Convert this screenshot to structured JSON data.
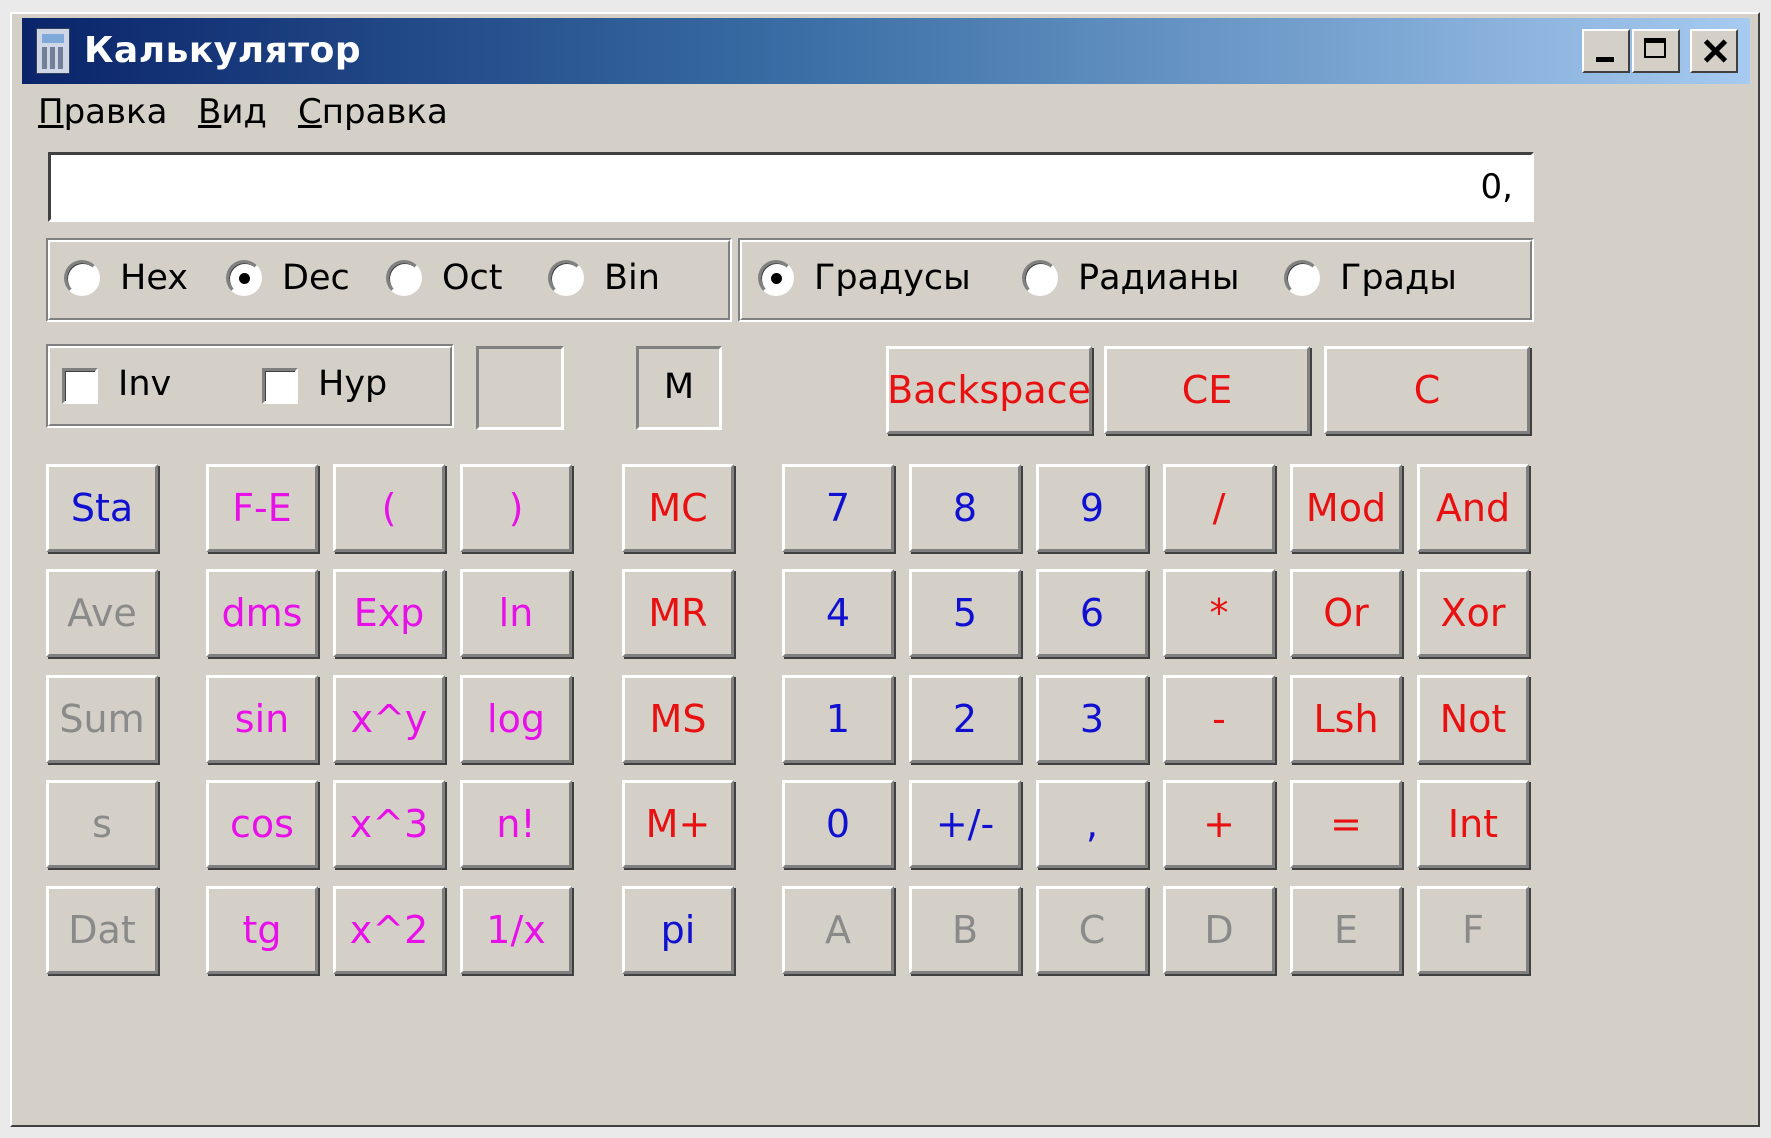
{
  "window": {
    "title": "Калькулятор"
  },
  "menu": [
    {
      "first": "П",
      "rest": "равка"
    },
    {
      "first": "В",
      "rest": "ид"
    },
    {
      "first": "С",
      "rest": "правка"
    }
  ],
  "display": {
    "value": "0,"
  },
  "base_modes": [
    {
      "label": "Hex",
      "selected": false
    },
    {
      "label": "Dec",
      "selected": true
    },
    {
      "label": "Oct",
      "selected": false
    },
    {
      "label": "Bin",
      "selected": false
    }
  ],
  "angle_modes": [
    {
      "label": "Градусы",
      "selected": true
    },
    {
      "label": "Радианы",
      "selected": false
    },
    {
      "label": "Грады",
      "selected": false
    }
  ],
  "checks": [
    {
      "label": "Inv",
      "checked": false
    },
    {
      "label": "Hyp",
      "checked": false
    }
  ],
  "paren_indicator": "",
  "memory_indicator": "M",
  "edit_buttons": [
    {
      "label": "Backspace",
      "color": "#e81010"
    },
    {
      "label": "CE",
      "color": "#e81010"
    },
    {
      "label": "C",
      "color": "#e81010"
    }
  ],
  "colors": {
    "red": "#e81010",
    "magenta": "#e810e8",
    "blue": "#1010d0",
    "gray": "#8a8a8a"
  },
  "keypad": [
    [
      {
        "label": "Sta",
        "color": "#1010d0",
        "enabled": true
      },
      {
        "label": "F-E",
        "color": "#e810e8",
        "enabled": true
      },
      {
        "label": "(",
        "color": "#e810e8",
        "enabled": true
      },
      {
        "label": ")",
        "color": "#e810e8",
        "enabled": true
      },
      {
        "label": "MC",
        "color": "#e81010",
        "enabled": true
      },
      {
        "label": "7",
        "color": "#1010d0",
        "enabled": true
      },
      {
        "label": "8",
        "color": "#1010d0",
        "enabled": true
      },
      {
        "label": "9",
        "color": "#1010d0",
        "enabled": true
      },
      {
        "label": "/",
        "color": "#e81010",
        "enabled": true
      },
      {
        "label": "Mod",
        "color": "#e81010",
        "enabled": true
      },
      {
        "label": "And",
        "color": "#e81010",
        "enabled": true
      }
    ],
    [
      {
        "label": "Ave",
        "color": "#8a8a8a",
        "enabled": false
      },
      {
        "label": "dms",
        "color": "#e810e8",
        "enabled": true
      },
      {
        "label": "Exp",
        "color": "#e810e8",
        "enabled": true
      },
      {
        "label": "ln",
        "color": "#e810e8",
        "enabled": true
      },
      {
        "label": "MR",
        "color": "#e81010",
        "enabled": true
      },
      {
        "label": "4",
        "color": "#1010d0",
        "enabled": true
      },
      {
        "label": "5",
        "color": "#1010d0",
        "enabled": true
      },
      {
        "label": "6",
        "color": "#1010d0",
        "enabled": true
      },
      {
        "label": "*",
        "color": "#e81010",
        "enabled": true
      },
      {
        "label": "Or",
        "color": "#e81010",
        "enabled": true
      },
      {
        "label": "Xor",
        "color": "#e81010",
        "enabled": true
      }
    ],
    [
      {
        "label": "Sum",
        "color": "#8a8a8a",
        "enabled": false
      },
      {
        "label": "sin",
        "color": "#e810e8",
        "enabled": true
      },
      {
        "label": "x^y",
        "color": "#e810e8",
        "enabled": true
      },
      {
        "label": "log",
        "color": "#e810e8",
        "enabled": true
      },
      {
        "label": "MS",
        "color": "#e81010",
        "enabled": true
      },
      {
        "label": "1",
        "color": "#1010d0",
        "enabled": true
      },
      {
        "label": "2",
        "color": "#1010d0",
        "enabled": true
      },
      {
        "label": "3",
        "color": "#1010d0",
        "enabled": true
      },
      {
        "label": "-",
        "color": "#e81010",
        "enabled": true
      },
      {
        "label": "Lsh",
        "color": "#e81010",
        "enabled": true
      },
      {
        "label": "Not",
        "color": "#e81010",
        "enabled": true
      }
    ],
    [
      {
        "label": "s",
        "color": "#8a8a8a",
        "enabled": false
      },
      {
        "label": "cos",
        "color": "#e810e8",
        "enabled": true
      },
      {
        "label": "x^3",
        "color": "#e810e8",
        "enabled": true
      },
      {
        "label": "n!",
        "color": "#e810e8",
        "enabled": true
      },
      {
        "label": "M+",
        "color": "#e81010",
        "enabled": true
      },
      {
        "label": "0",
        "color": "#1010d0",
        "enabled": true
      },
      {
        "label": "+/-",
        "color": "#1010d0",
        "enabled": true
      },
      {
        "label": ",",
        "color": "#1010d0",
        "enabled": true
      },
      {
        "label": "+",
        "color": "#e81010",
        "enabled": true
      },
      {
        "label": "=",
        "color": "#e81010",
        "enabled": true
      },
      {
        "label": "Int",
        "color": "#e81010",
        "enabled": true
      }
    ],
    [
      {
        "label": "Dat",
        "color": "#8a8a8a",
        "enabled": false
      },
      {
        "label": "tg",
        "color": "#e810e8",
        "enabled": true
      },
      {
        "label": "x^2",
        "color": "#e810e8",
        "enabled": true
      },
      {
        "label": "1/x",
        "color": "#e810e8",
        "enabled": true
      },
      {
        "label": "pi",
        "color": "#1010d0",
        "enabled": true
      },
      {
        "label": "A",
        "color": "#8a8a8a",
        "enabled": false
      },
      {
        "label": "B",
        "color": "#8a8a8a",
        "enabled": false
      },
      {
        "label": "C",
        "color": "#8a8a8a",
        "enabled": false
      },
      {
        "label": "D",
        "color": "#8a8a8a",
        "enabled": false
      },
      {
        "label": "E",
        "color": "#8a8a8a",
        "enabled": false
      },
      {
        "label": "F",
        "color": "#8a8a8a",
        "enabled": false
      }
    ]
  ]
}
